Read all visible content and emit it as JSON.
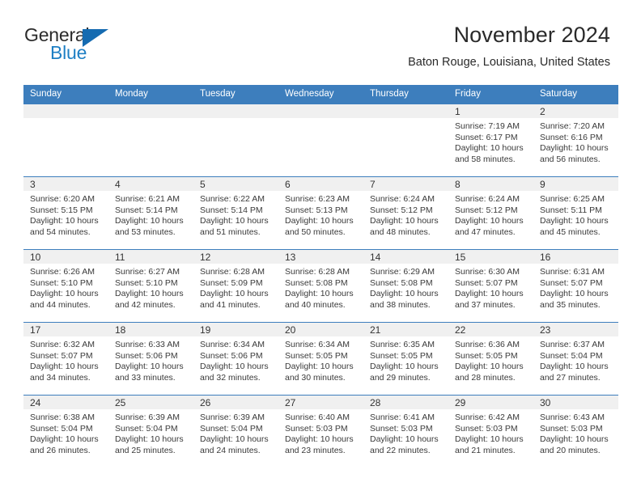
{
  "brand": {
    "name_line1": "General",
    "name_line2": "Blue",
    "accent_color": "#1e7fc4",
    "logo_triangle_color": "#156bb1"
  },
  "header": {
    "title": "November 2024",
    "subtitle": "Baton Rouge, Louisiana, United States"
  },
  "theme": {
    "header_bar_color": "#3d7ebd",
    "date_band_color": "#f0f0f0",
    "text_color": "#3a3a3a"
  },
  "calendar": {
    "weekday_headers": [
      "Sunday",
      "Monday",
      "Tuesday",
      "Wednesday",
      "Thursday",
      "Friday",
      "Saturday"
    ],
    "weeks": [
      [
        {
          "day": "",
          "empty": true
        },
        {
          "day": "",
          "empty": true
        },
        {
          "day": "",
          "empty": true
        },
        {
          "day": "",
          "empty": true
        },
        {
          "day": "",
          "empty": true
        },
        {
          "day": "1",
          "sunrise": "Sunrise: 7:19 AM",
          "sunset": "Sunset: 6:17 PM",
          "daylight": "Daylight: 10 hours and 58 minutes."
        },
        {
          "day": "2",
          "sunrise": "Sunrise: 7:20 AM",
          "sunset": "Sunset: 6:16 PM",
          "daylight": "Daylight: 10 hours and 56 minutes."
        }
      ],
      [
        {
          "day": "3",
          "sunrise": "Sunrise: 6:20 AM",
          "sunset": "Sunset: 5:15 PM",
          "daylight": "Daylight: 10 hours and 54 minutes."
        },
        {
          "day": "4",
          "sunrise": "Sunrise: 6:21 AM",
          "sunset": "Sunset: 5:14 PM",
          "daylight": "Daylight: 10 hours and 53 minutes."
        },
        {
          "day": "5",
          "sunrise": "Sunrise: 6:22 AM",
          "sunset": "Sunset: 5:14 PM",
          "daylight": "Daylight: 10 hours and 51 minutes."
        },
        {
          "day": "6",
          "sunrise": "Sunrise: 6:23 AM",
          "sunset": "Sunset: 5:13 PM",
          "daylight": "Daylight: 10 hours and 50 minutes."
        },
        {
          "day": "7",
          "sunrise": "Sunrise: 6:24 AM",
          "sunset": "Sunset: 5:12 PM",
          "daylight": "Daylight: 10 hours and 48 minutes."
        },
        {
          "day": "8",
          "sunrise": "Sunrise: 6:24 AM",
          "sunset": "Sunset: 5:12 PM",
          "daylight": "Daylight: 10 hours and 47 minutes."
        },
        {
          "day": "9",
          "sunrise": "Sunrise: 6:25 AM",
          "sunset": "Sunset: 5:11 PM",
          "daylight": "Daylight: 10 hours and 45 minutes."
        }
      ],
      [
        {
          "day": "10",
          "sunrise": "Sunrise: 6:26 AM",
          "sunset": "Sunset: 5:10 PM",
          "daylight": "Daylight: 10 hours and 44 minutes."
        },
        {
          "day": "11",
          "sunrise": "Sunrise: 6:27 AM",
          "sunset": "Sunset: 5:10 PM",
          "daylight": "Daylight: 10 hours and 42 minutes."
        },
        {
          "day": "12",
          "sunrise": "Sunrise: 6:28 AM",
          "sunset": "Sunset: 5:09 PM",
          "daylight": "Daylight: 10 hours and 41 minutes."
        },
        {
          "day": "13",
          "sunrise": "Sunrise: 6:28 AM",
          "sunset": "Sunset: 5:08 PM",
          "daylight": "Daylight: 10 hours and 40 minutes."
        },
        {
          "day": "14",
          "sunrise": "Sunrise: 6:29 AM",
          "sunset": "Sunset: 5:08 PM",
          "daylight": "Daylight: 10 hours and 38 minutes."
        },
        {
          "day": "15",
          "sunrise": "Sunrise: 6:30 AM",
          "sunset": "Sunset: 5:07 PM",
          "daylight": "Daylight: 10 hours and 37 minutes."
        },
        {
          "day": "16",
          "sunrise": "Sunrise: 6:31 AM",
          "sunset": "Sunset: 5:07 PM",
          "daylight": "Daylight: 10 hours and 35 minutes."
        }
      ],
      [
        {
          "day": "17",
          "sunrise": "Sunrise: 6:32 AM",
          "sunset": "Sunset: 5:07 PM",
          "daylight": "Daylight: 10 hours and 34 minutes."
        },
        {
          "day": "18",
          "sunrise": "Sunrise: 6:33 AM",
          "sunset": "Sunset: 5:06 PM",
          "daylight": "Daylight: 10 hours and 33 minutes."
        },
        {
          "day": "19",
          "sunrise": "Sunrise: 6:34 AM",
          "sunset": "Sunset: 5:06 PM",
          "daylight": "Daylight: 10 hours and 32 minutes."
        },
        {
          "day": "20",
          "sunrise": "Sunrise: 6:34 AM",
          "sunset": "Sunset: 5:05 PM",
          "daylight": "Daylight: 10 hours and 30 minutes."
        },
        {
          "day": "21",
          "sunrise": "Sunrise: 6:35 AM",
          "sunset": "Sunset: 5:05 PM",
          "daylight": "Daylight: 10 hours and 29 minutes."
        },
        {
          "day": "22",
          "sunrise": "Sunrise: 6:36 AM",
          "sunset": "Sunset: 5:05 PM",
          "daylight": "Daylight: 10 hours and 28 minutes."
        },
        {
          "day": "23",
          "sunrise": "Sunrise: 6:37 AM",
          "sunset": "Sunset: 5:04 PM",
          "daylight": "Daylight: 10 hours and 27 minutes."
        }
      ],
      [
        {
          "day": "24",
          "sunrise": "Sunrise: 6:38 AM",
          "sunset": "Sunset: 5:04 PM",
          "daylight": "Daylight: 10 hours and 26 minutes."
        },
        {
          "day": "25",
          "sunrise": "Sunrise: 6:39 AM",
          "sunset": "Sunset: 5:04 PM",
          "daylight": "Daylight: 10 hours and 25 minutes."
        },
        {
          "day": "26",
          "sunrise": "Sunrise: 6:39 AM",
          "sunset": "Sunset: 5:04 PM",
          "daylight": "Daylight: 10 hours and 24 minutes."
        },
        {
          "day": "27",
          "sunrise": "Sunrise: 6:40 AM",
          "sunset": "Sunset: 5:03 PM",
          "daylight": "Daylight: 10 hours and 23 minutes."
        },
        {
          "day": "28",
          "sunrise": "Sunrise: 6:41 AM",
          "sunset": "Sunset: 5:03 PM",
          "daylight": "Daylight: 10 hours and 22 minutes."
        },
        {
          "day": "29",
          "sunrise": "Sunrise: 6:42 AM",
          "sunset": "Sunset: 5:03 PM",
          "daylight": "Daylight: 10 hours and 21 minutes."
        },
        {
          "day": "30",
          "sunrise": "Sunrise: 6:43 AM",
          "sunset": "Sunset: 5:03 PM",
          "daylight": "Daylight: 10 hours and 20 minutes."
        }
      ]
    ]
  }
}
